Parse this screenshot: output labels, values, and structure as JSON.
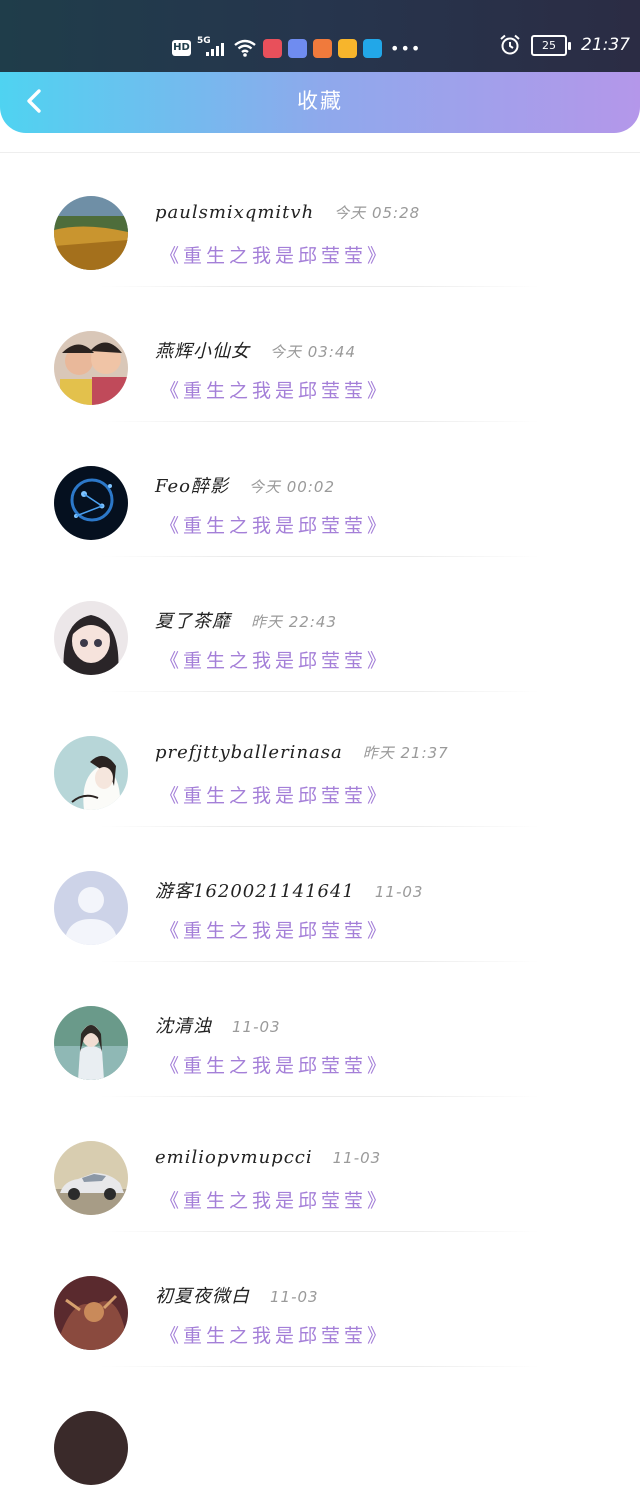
{
  "status_bar": {
    "network_label": "HD",
    "signal_label": "5G",
    "battery": "25",
    "time": "21:37",
    "app_icon_colors": [
      "#e8505b",
      "#6f8cf0",
      "#f07a3c",
      "#f7b52c",
      "#22a7e8"
    ]
  },
  "header": {
    "title": "收藏",
    "gradient": [
      "#4fd3f1",
      "#b497ea"
    ]
  },
  "favorites": [
    {
      "username": "paulsmixqmitvh",
      "time": "今天 05:28",
      "book": "《重生之我是邱莹莹》",
      "avatar": "landscape"
    },
    {
      "username": "燕辉小仙女",
      "time": "今天 03:44",
      "book": "《重生之我是邱莹莹》",
      "avatar": "kids-photo"
    },
    {
      "username": "Feo醉影",
      "time": "今天 00:02",
      "book": "《重生之我是邱莹莹》",
      "avatar": "constellation"
    },
    {
      "username": "夏了茶靡",
      "time": "昨天 22:43",
      "book": "《重生之我是邱莹莹》",
      "avatar": "anime-girl"
    },
    {
      "username": "prefjttyballerinasa",
      "time": "昨天 21:37",
      "book": "《重生之我是邱莹莹》",
      "avatar": "sketch-girl"
    },
    {
      "username": "游客1620021141641",
      "time": "11-03",
      "book": "《重生之我是邱莹莹》",
      "avatar": "default-user"
    },
    {
      "username": "沈清浊",
      "time": "11-03",
      "book": "《重生之我是邱莹莹》",
      "avatar": "girl-portrait"
    },
    {
      "username": "emiliopvmupcci",
      "time": "11-03",
      "book": "《重生之我是邱莹莹》",
      "avatar": "car"
    },
    {
      "username": "初夏夜微白",
      "time": "11-03",
      "book": "《重生之我是邱莹莹》",
      "avatar": "dragon"
    }
  ],
  "colors": {
    "book_title": "#a47fd8",
    "time": "#9a9a9a",
    "username": "#222222"
  }
}
